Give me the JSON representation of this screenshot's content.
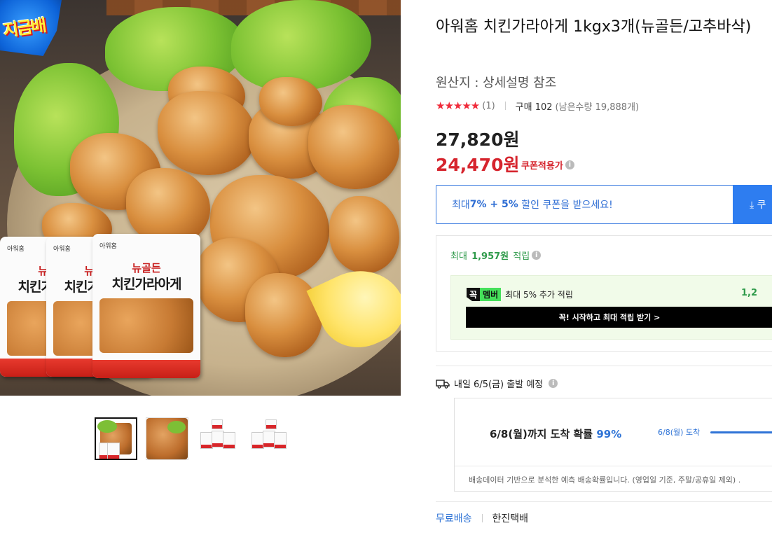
{
  "product": {
    "badge": "지금배",
    "title": "아워홈 치킨가라아게 1kgx3개(뉴골든/고추바삭)",
    "origin": "원산지 : 상세설명 참조",
    "rating_stars": "★★★★★",
    "review_count": "(1)",
    "purchase_count": "구매 102",
    "remaining": "(남은수량 19,888개)",
    "rating_value": 5
  },
  "package": {
    "brand": "아워홈",
    "line1": "뉴골든",
    "line2": "치킨가라아게",
    "pack_brand_small": "뉴골든",
    "pack_line_small": "치킨가"
  },
  "thumbnails": [
    {
      "name": "thumb-1",
      "active": true
    },
    {
      "name": "thumb-2",
      "active": false
    },
    {
      "name": "thumb-3",
      "active": false
    },
    {
      "name": "thumb-4",
      "active": false
    }
  ],
  "price": {
    "original": "27,820원",
    "sale": "24,470원",
    "coupon_label": "쿠폰적용가",
    "info_icon": "info-icon"
  },
  "coupon": {
    "prefix": "최대 ",
    "pct1": "7%",
    "plus": " + ",
    "pct2": "5%",
    "suffix": " 할인 쿠폰을 받으세요!",
    "button": "⤓ 쿠"
  },
  "reward": {
    "prefix": "최대 ",
    "amount": "1,957원",
    "suffix": " 적립",
    "member_tag1": "꼭",
    "member_tag2": "멤버",
    "member_text": "최대 5% 추가 적립",
    "member_amount": "1,2",
    "member_button": "꼭! 시작하고 최대 적립 받기 >"
  },
  "shipping": {
    "depart": "내일 6/5(금) 출발 예정",
    "arrive_main": "6/8(월)까지 도착 확률 ",
    "arrive_pct": "99%",
    "arrive_mini": "6/8(월) 도착",
    "note": "배송데이터 기반으로 분석한 예측 배송확률입니다. (영업일 기준, 주말/공휴일 제외) .",
    "free": "무료배송",
    "courier": "한진택배"
  },
  "colors": {
    "sale_red": "#d6252e",
    "link_blue": "#2e73d6",
    "reward_green": "#2e9a4a"
  }
}
